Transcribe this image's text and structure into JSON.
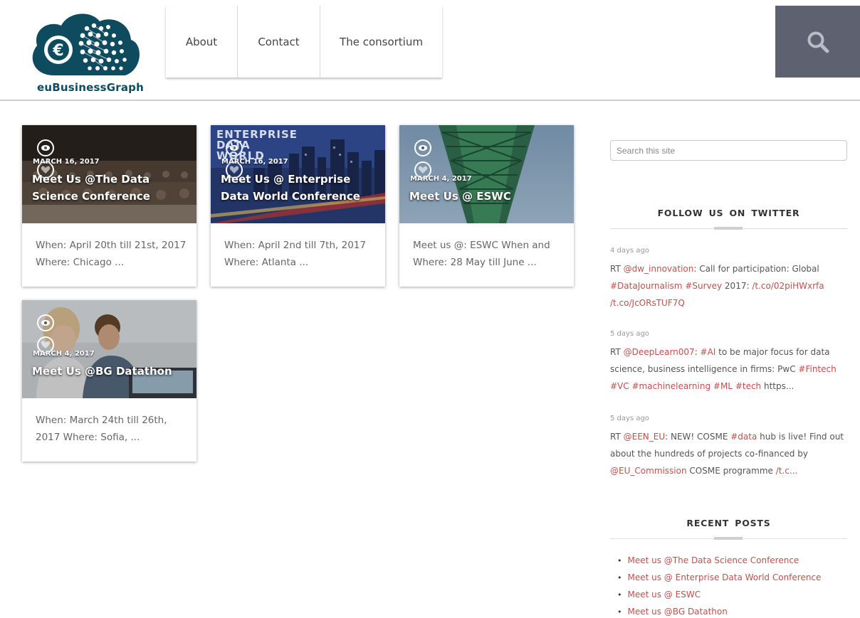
{
  "header": {
    "logo_text": "euBusinessGraph",
    "nav": [
      {
        "label": "About"
      },
      {
        "label": "Contact"
      },
      {
        "label": "The consortium"
      }
    ],
    "search_icon": "search-icon"
  },
  "posts": [
    {
      "date": "MARCH 16, 2017",
      "title": "Meet Us @The Data Science Conference",
      "excerpt": "When: April 20th till 21st, 2017 Where: Chicago ...",
      "image": "conference-hall-photo"
    },
    {
      "date": "MARCH 16, 2017",
      "title": "Meet Us @ Enterprise Data World Conference",
      "excerpt": "When: April 2nd till 7th, 2017 Where: Atlanta ...",
      "image": "city-night-photo",
      "image_text": "ENTERPRISE DATA WORLD"
    },
    {
      "date": "MARCH 4, 2017",
      "title": "Meet Us @ ESWC",
      "excerpt": "Meet us @: ESWC When and Where: 28 May till June ...",
      "image": "bridge-photo"
    },
    {
      "date": "MARCH 4, 2017",
      "title": "Meet Us @BG Datathon",
      "excerpt": "When: March 24th till 26th, 2017 Where: Sofia, ...",
      "image": "datathon-photo"
    }
  ],
  "sidebar": {
    "search_placeholder": "Search this site",
    "twitter_title": "FOLLOW US ON TWITTER",
    "tweets": [
      {
        "time": "4 days ago"
      },
      {
        "time": "5 days ago"
      },
      {
        "time": "5 days ago"
      }
    ],
    "recent_title": "RECENT POSTS",
    "recent_posts": [
      "Meet us @The Data Science Conference",
      "Meet us @ Enterprise Data World Conference",
      "Meet us @ ESWC",
      "Meet us @BG Datathon"
    ]
  },
  "colors": {
    "brand": "#0e4b5e",
    "link": "#c0504d",
    "search_button": "#5e6270"
  }
}
